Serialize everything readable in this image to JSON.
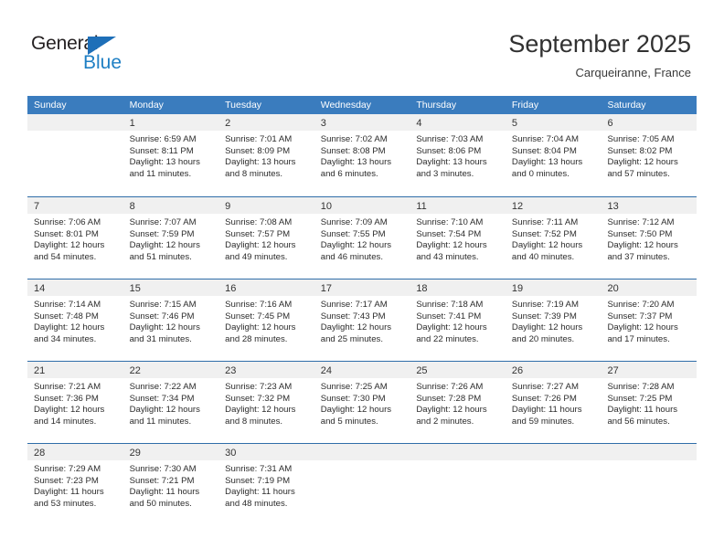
{
  "brand": {
    "name_part1": "General",
    "name_part2": "Blue",
    "triangle_color": "#1e6fb8",
    "blue_text_color": "#1e7fc4"
  },
  "header": {
    "title": "September 2025",
    "subtitle": "Carqueiranne, France"
  },
  "calendar": {
    "header_bg": "#3a7cbe",
    "weekdays": [
      "Sunday",
      "Monday",
      "Tuesday",
      "Wednesday",
      "Thursday",
      "Friday",
      "Saturday"
    ],
    "labels": {
      "sunrise": "Sunrise:",
      "sunset": "Sunset:",
      "daylight": "Daylight:"
    },
    "weeks": [
      [
        {
          "day": ""
        },
        {
          "day": "1",
          "sunrise": "Sunrise: 6:59 AM",
          "sunset": "Sunset: 8:11 PM",
          "daylight_line1": "Daylight: 13 hours",
          "daylight_line2": "and 11 minutes."
        },
        {
          "day": "2",
          "sunrise": "Sunrise: 7:01 AM",
          "sunset": "Sunset: 8:09 PM",
          "daylight_line1": "Daylight: 13 hours",
          "daylight_line2": "and 8 minutes."
        },
        {
          "day": "3",
          "sunrise": "Sunrise: 7:02 AM",
          "sunset": "Sunset: 8:08 PM",
          "daylight_line1": "Daylight: 13 hours",
          "daylight_line2": "and 6 minutes."
        },
        {
          "day": "4",
          "sunrise": "Sunrise: 7:03 AM",
          "sunset": "Sunset: 8:06 PM",
          "daylight_line1": "Daylight: 13 hours",
          "daylight_line2": "and 3 minutes."
        },
        {
          "day": "5",
          "sunrise": "Sunrise: 7:04 AM",
          "sunset": "Sunset: 8:04 PM",
          "daylight_line1": "Daylight: 13 hours",
          "daylight_line2": "and 0 minutes."
        },
        {
          "day": "6",
          "sunrise": "Sunrise: 7:05 AM",
          "sunset": "Sunset: 8:02 PM",
          "daylight_line1": "Daylight: 12 hours",
          "daylight_line2": "and 57 minutes."
        }
      ],
      [
        {
          "day": "7",
          "sunrise": "Sunrise: 7:06 AM",
          "sunset": "Sunset: 8:01 PM",
          "daylight_line1": "Daylight: 12 hours",
          "daylight_line2": "and 54 minutes."
        },
        {
          "day": "8",
          "sunrise": "Sunrise: 7:07 AM",
          "sunset": "Sunset: 7:59 PM",
          "daylight_line1": "Daylight: 12 hours",
          "daylight_line2": "and 51 minutes."
        },
        {
          "day": "9",
          "sunrise": "Sunrise: 7:08 AM",
          "sunset": "Sunset: 7:57 PM",
          "daylight_line1": "Daylight: 12 hours",
          "daylight_line2": "and 49 minutes."
        },
        {
          "day": "10",
          "sunrise": "Sunrise: 7:09 AM",
          "sunset": "Sunset: 7:55 PM",
          "daylight_line1": "Daylight: 12 hours",
          "daylight_line2": "and 46 minutes."
        },
        {
          "day": "11",
          "sunrise": "Sunrise: 7:10 AM",
          "sunset": "Sunset: 7:54 PM",
          "daylight_line1": "Daylight: 12 hours",
          "daylight_line2": "and 43 minutes."
        },
        {
          "day": "12",
          "sunrise": "Sunrise: 7:11 AM",
          "sunset": "Sunset: 7:52 PM",
          "daylight_line1": "Daylight: 12 hours",
          "daylight_line2": "and 40 minutes."
        },
        {
          "day": "13",
          "sunrise": "Sunrise: 7:12 AM",
          "sunset": "Sunset: 7:50 PM",
          "daylight_line1": "Daylight: 12 hours",
          "daylight_line2": "and 37 minutes."
        }
      ],
      [
        {
          "day": "14",
          "sunrise": "Sunrise: 7:14 AM",
          "sunset": "Sunset: 7:48 PM",
          "daylight_line1": "Daylight: 12 hours",
          "daylight_line2": "and 34 minutes."
        },
        {
          "day": "15",
          "sunrise": "Sunrise: 7:15 AM",
          "sunset": "Sunset: 7:46 PM",
          "daylight_line1": "Daylight: 12 hours",
          "daylight_line2": "and 31 minutes."
        },
        {
          "day": "16",
          "sunrise": "Sunrise: 7:16 AM",
          "sunset": "Sunset: 7:45 PM",
          "daylight_line1": "Daylight: 12 hours",
          "daylight_line2": "and 28 minutes."
        },
        {
          "day": "17",
          "sunrise": "Sunrise: 7:17 AM",
          "sunset": "Sunset: 7:43 PM",
          "daylight_line1": "Daylight: 12 hours",
          "daylight_line2": "and 25 minutes."
        },
        {
          "day": "18",
          "sunrise": "Sunrise: 7:18 AM",
          "sunset": "Sunset: 7:41 PM",
          "daylight_line1": "Daylight: 12 hours",
          "daylight_line2": "and 22 minutes."
        },
        {
          "day": "19",
          "sunrise": "Sunrise: 7:19 AM",
          "sunset": "Sunset: 7:39 PM",
          "daylight_line1": "Daylight: 12 hours",
          "daylight_line2": "and 20 minutes."
        },
        {
          "day": "20",
          "sunrise": "Sunrise: 7:20 AM",
          "sunset": "Sunset: 7:37 PM",
          "daylight_line1": "Daylight: 12 hours",
          "daylight_line2": "and 17 minutes."
        }
      ],
      [
        {
          "day": "21",
          "sunrise": "Sunrise: 7:21 AM",
          "sunset": "Sunset: 7:36 PM",
          "daylight_line1": "Daylight: 12 hours",
          "daylight_line2": "and 14 minutes."
        },
        {
          "day": "22",
          "sunrise": "Sunrise: 7:22 AM",
          "sunset": "Sunset: 7:34 PM",
          "daylight_line1": "Daylight: 12 hours",
          "daylight_line2": "and 11 minutes."
        },
        {
          "day": "23",
          "sunrise": "Sunrise: 7:23 AM",
          "sunset": "Sunset: 7:32 PM",
          "daylight_line1": "Daylight: 12 hours",
          "daylight_line2": "and 8 minutes."
        },
        {
          "day": "24",
          "sunrise": "Sunrise: 7:25 AM",
          "sunset": "Sunset: 7:30 PM",
          "daylight_line1": "Daylight: 12 hours",
          "daylight_line2": "and 5 minutes."
        },
        {
          "day": "25",
          "sunrise": "Sunrise: 7:26 AM",
          "sunset": "Sunset: 7:28 PM",
          "daylight_line1": "Daylight: 12 hours",
          "daylight_line2": "and 2 minutes."
        },
        {
          "day": "26",
          "sunrise": "Sunrise: 7:27 AM",
          "sunset": "Sunset: 7:26 PM",
          "daylight_line1": "Daylight: 11 hours",
          "daylight_line2": "and 59 minutes."
        },
        {
          "day": "27",
          "sunrise": "Sunrise: 7:28 AM",
          "sunset": "Sunset: 7:25 PM",
          "daylight_line1": "Daylight: 11 hours",
          "daylight_line2": "and 56 minutes."
        }
      ],
      [
        {
          "day": "28",
          "sunrise": "Sunrise: 7:29 AM",
          "sunset": "Sunset: 7:23 PM",
          "daylight_line1": "Daylight: 11 hours",
          "daylight_line2": "and 53 minutes."
        },
        {
          "day": "29",
          "sunrise": "Sunrise: 7:30 AM",
          "sunset": "Sunset: 7:21 PM",
          "daylight_line1": "Daylight: 11 hours",
          "daylight_line2": "and 50 minutes."
        },
        {
          "day": "30",
          "sunrise": "Sunrise: 7:31 AM",
          "sunset": "Sunset: 7:19 PM",
          "daylight_line1": "Daylight: 11 hours",
          "daylight_line2": "and 48 minutes."
        },
        {
          "day": ""
        },
        {
          "day": ""
        },
        {
          "day": ""
        },
        {
          "day": ""
        }
      ]
    ]
  }
}
